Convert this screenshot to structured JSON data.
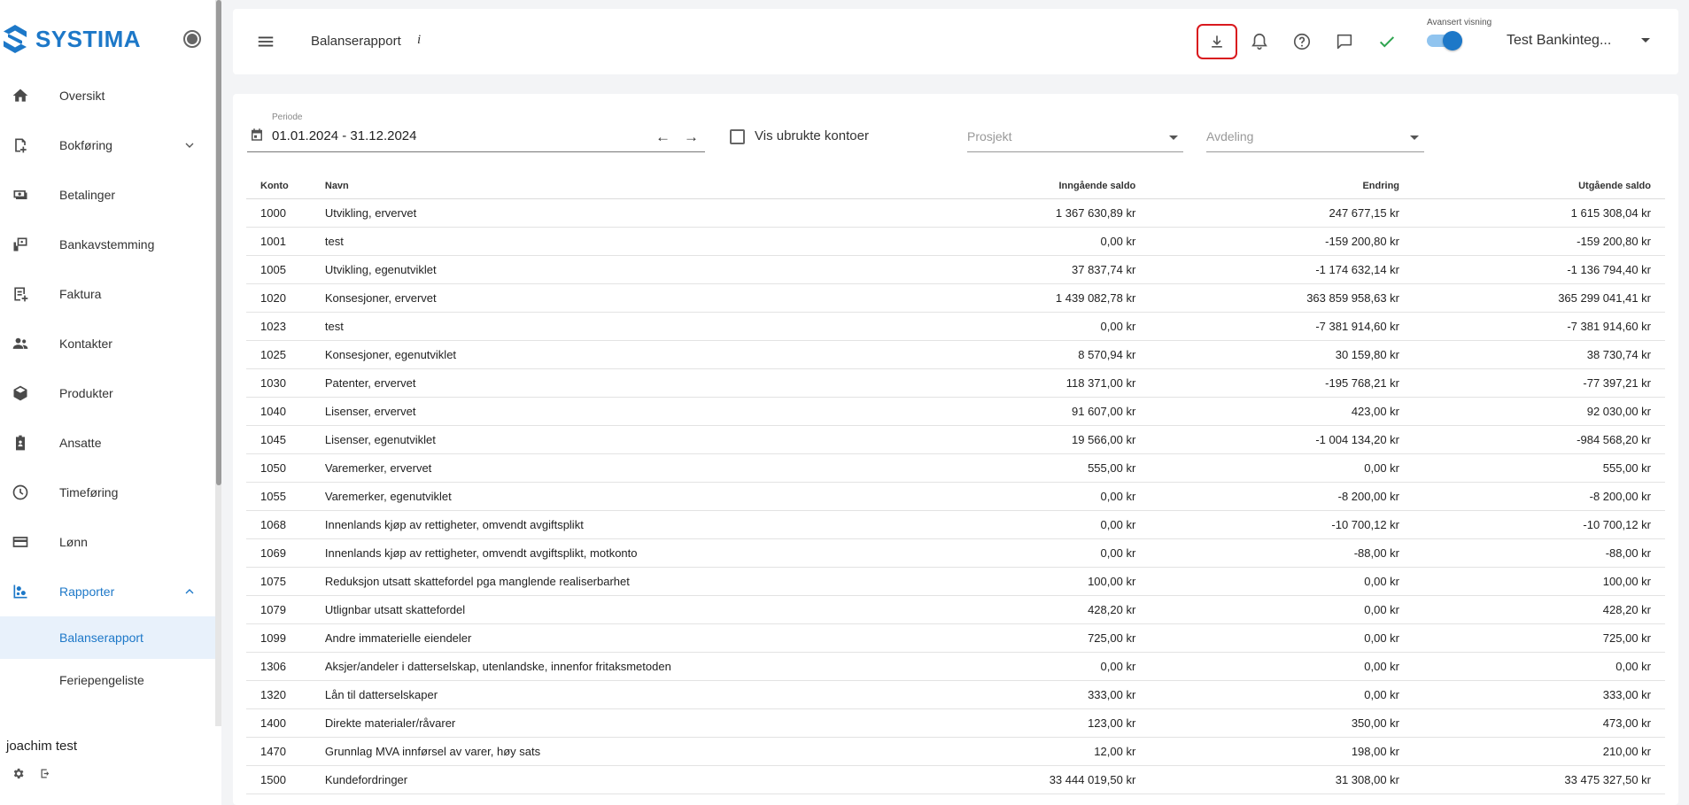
{
  "app": {
    "brand": "SYSTIMA"
  },
  "sidebar": {
    "items": [
      {
        "label": "Oversikt",
        "icon": "home-icon"
      },
      {
        "label": "Bokføring",
        "icon": "ledger-icon",
        "expandable": true
      },
      {
        "label": "Betalinger",
        "icon": "money-icon"
      },
      {
        "label": "Bankavstemming",
        "icon": "bank-icon"
      },
      {
        "label": "Faktura",
        "icon": "invoice-icon"
      },
      {
        "label": "Kontakter",
        "icon": "people-icon"
      },
      {
        "label": "Produkter",
        "icon": "box-icon"
      },
      {
        "label": "Ansatte",
        "icon": "badge-icon"
      },
      {
        "label": "Timeføring",
        "icon": "clock-icon"
      },
      {
        "label": "Lønn",
        "icon": "card-icon"
      },
      {
        "label": "Rapporter",
        "icon": "report-icon",
        "expanded": true,
        "active": true
      }
    ],
    "sub_items": [
      {
        "label": "Balanserapport",
        "selected": true
      },
      {
        "label": "Feriepengeliste"
      }
    ],
    "user": {
      "name": "joachim test"
    }
  },
  "header": {
    "title": "Balanserapport",
    "info": "i",
    "advanced_label": "Avansert visning",
    "advanced_on": true,
    "company": "Test Bankinteg..."
  },
  "filters": {
    "period_label": "Periode",
    "period_value": "01.01.2024 - 31.12.2024",
    "arrow_prev": "←",
    "arrow_next": "→",
    "unused_accounts_label": "Vis ubrukte kontoer",
    "project_placeholder": "Prosjekt",
    "department_placeholder": "Avdeling"
  },
  "table": {
    "columns": [
      "Konto",
      "Navn",
      "Inngående saldo",
      "Endring",
      "Utgående saldo"
    ],
    "rows": [
      [
        "1000",
        "Utvikling, ervervet",
        "1 367 630,89 kr",
        "247 677,15 kr",
        "1 615 308,04 kr"
      ],
      [
        "1001",
        "test",
        "0,00 kr",
        "-159 200,80 kr",
        "-159 200,80 kr"
      ],
      [
        "1005",
        "Utvikling, egenutviklet",
        "37 837,74 kr",
        "-1 174 632,14 kr",
        "-1 136 794,40 kr"
      ],
      [
        "1020",
        "Konsesjoner, ervervet",
        "1 439 082,78 kr",
        "363 859 958,63 kr",
        "365 299 041,41 kr"
      ],
      [
        "1023",
        "test",
        "0,00 kr",
        "-7 381 914,60 kr",
        "-7 381 914,60 kr"
      ],
      [
        "1025",
        "Konsesjoner, egenutviklet",
        "8 570,94 kr",
        "30 159,80 kr",
        "38 730,74 kr"
      ],
      [
        "1030",
        "Patenter, ervervet",
        "118 371,00 kr",
        "-195 768,21 kr",
        "-77 397,21 kr"
      ],
      [
        "1040",
        "Lisenser, ervervet",
        "91 607,00 kr",
        "423,00 kr",
        "92 030,00 kr"
      ],
      [
        "1045",
        "Lisenser, egenutviklet",
        "19 566,00 kr",
        "-1 004 134,20 kr",
        "-984 568,20 kr"
      ],
      [
        "1050",
        "Varemerker, ervervet",
        "555,00 kr",
        "0,00 kr",
        "555,00 kr"
      ],
      [
        "1055",
        "Varemerker, egenutviklet",
        "0,00 kr",
        "-8 200,00 kr",
        "-8 200,00 kr"
      ],
      [
        "1068",
        "Innenlands kjøp av rettigheter, omvendt avgiftsplikt",
        "0,00 kr",
        "-10 700,12 kr",
        "-10 700,12 kr"
      ],
      [
        "1069",
        "Innenlands kjøp av rettigheter, omvendt avgiftsplikt, motkonto",
        "0,00 kr",
        "-88,00 kr",
        "-88,00 kr"
      ],
      [
        "1075",
        "Reduksjon utsatt skattefordel pga manglende realiserbarhet",
        "100,00 kr",
        "0,00 kr",
        "100,00 kr"
      ],
      [
        "1079",
        "Utlignbar utsatt skattefordel",
        "428,20 kr",
        "0,00 kr",
        "428,20 kr"
      ],
      [
        "1099",
        "Andre immaterielle eiendeler",
        "725,00 kr",
        "0,00 kr",
        "725,00 kr"
      ],
      [
        "1306",
        "Aksjer/andeler i datterselskap, utenlandske, innenfor fritaksmetoden",
        "0,00 kr",
        "0,00 kr",
        "0,00 kr"
      ],
      [
        "1320",
        "Lån til datterselskaper",
        "333,00 kr",
        "0,00 kr",
        "333,00 kr"
      ],
      [
        "1400",
        "Direkte materialer/råvarer",
        "123,00 kr",
        "350,00 kr",
        "473,00 kr"
      ],
      [
        "1470",
        "Grunnlag MVA innførsel av varer, høy sats",
        "12,00 kr",
        "198,00 kr",
        "210,00 kr"
      ],
      [
        "1500",
        "Kundefordringer",
        "33 444 019,50 kr",
        "31 308,00 kr",
        "33 475 327,50 kr"
      ]
    ]
  },
  "colors": {
    "accent": "#1d78c8",
    "highlight_border": "#d9191e",
    "check": "#2ea44f"
  }
}
